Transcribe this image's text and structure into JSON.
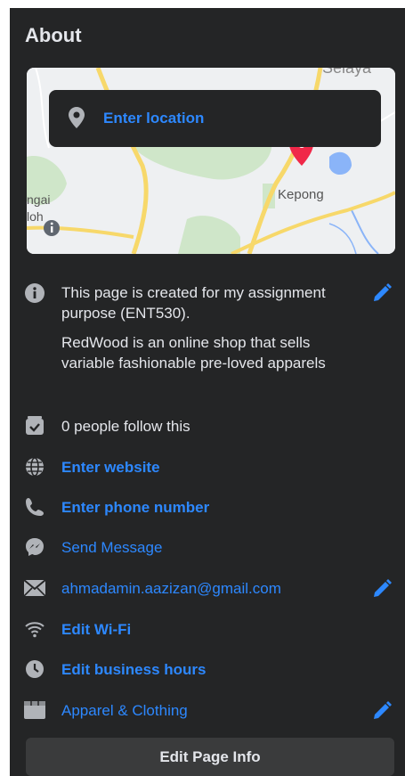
{
  "about": {
    "title": "About",
    "map": {
      "location_placeholder": "Enter location",
      "labels": [
        "Kepong",
        "ngai",
        "loh",
        "Selaya"
      ]
    },
    "description": {
      "line1": "This page is created for my assignment purpose (ENT530).",
      "line2": "RedWood is an online shop that sells variable fashionable pre-loved apparels"
    },
    "followers": "0 people follow this",
    "website": "Enter website",
    "phone": "Enter phone number",
    "message": "Send Message",
    "email": "ahmadamin.aazizan@gmail.com",
    "wifi": "Edit Wi-Fi",
    "hours": "Edit business hours",
    "category": "Apparel & Clothing",
    "edit_button": "Edit Page Info"
  },
  "colors": {
    "background": "#242526",
    "link": "#2d88ff",
    "text": "#e4e6eb",
    "button": "#3a3b3c",
    "map_pin": "#f02849"
  },
  "icons": [
    "location-pin-icon",
    "info-icon",
    "followers-icon",
    "globe-icon",
    "phone-icon",
    "messenger-icon",
    "mail-icon",
    "wifi-icon",
    "clock-icon",
    "category-icon",
    "pencil-icon"
  ]
}
